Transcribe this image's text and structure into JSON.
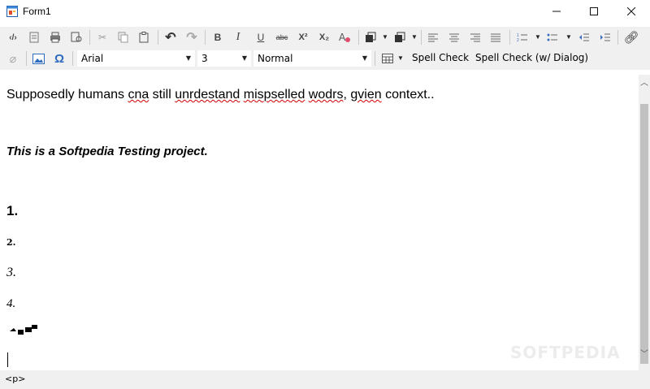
{
  "window": {
    "title": "Form1",
    "controls": {
      "minimize": "minimize-icon",
      "maximize": "maximize-icon",
      "close": "close-icon"
    }
  },
  "toolbar": {
    "row1_icons": [
      "html-source-icon",
      "document-icon",
      "print-icon",
      "print-preview-icon",
      "cut-icon",
      "copy-icon",
      "paste-icon",
      "undo-icon",
      "redo-icon",
      "bold-icon",
      "italic-icon",
      "underline-icon",
      "strikethrough-icon",
      "superscript-icon",
      "subscript-icon",
      "clear-format-icon",
      "text-color-icon",
      "highlight-color-icon",
      "align-left-icon",
      "align-center-icon",
      "align-right-icon",
      "justify-icon",
      "numbered-list-icon",
      "bulleted-list-icon",
      "outdent-icon",
      "indent-icon",
      "link-icon"
    ],
    "labels": {
      "bold": "B",
      "italic": "I",
      "underline": "U",
      "strike": "abc",
      "superscript": "X²",
      "subscript": "X₂"
    },
    "font_name": "Arial",
    "font_size": "3",
    "paragraph_style": "Normal",
    "spell_check_label": "Spell Check",
    "spell_check_dialog_label": "Spell Check (w/ Dialog)"
  },
  "editor": {
    "line1_prefix": "Supposedly humans ",
    "line1_words": [
      {
        "text": "cna",
        "misspelled": true
      },
      {
        "text": " still ",
        "misspelled": false
      },
      {
        "text": "unrdestand",
        "misspelled": true
      },
      {
        "text": " ",
        "misspelled": false
      },
      {
        "text": "mispselled",
        "misspelled": true
      },
      {
        "text": " ",
        "misspelled": false
      },
      {
        "text": "wodrs",
        "misspelled": true
      },
      {
        "text": ", ",
        "misspelled": false
      },
      {
        "text": "gvien",
        "misspelled": true
      },
      {
        "text": " context..",
        "misspelled": false
      }
    ],
    "line2": "This is a Softpedia Testing project.",
    "list_items": [
      "1.",
      "2.",
      "3.",
      "4."
    ],
    "scrollbar": {
      "up": "chevron-up-icon",
      "down": "chevron-down-icon"
    }
  },
  "status": {
    "tag": "<p>"
  },
  "watermark": "SOFTPEDIA"
}
